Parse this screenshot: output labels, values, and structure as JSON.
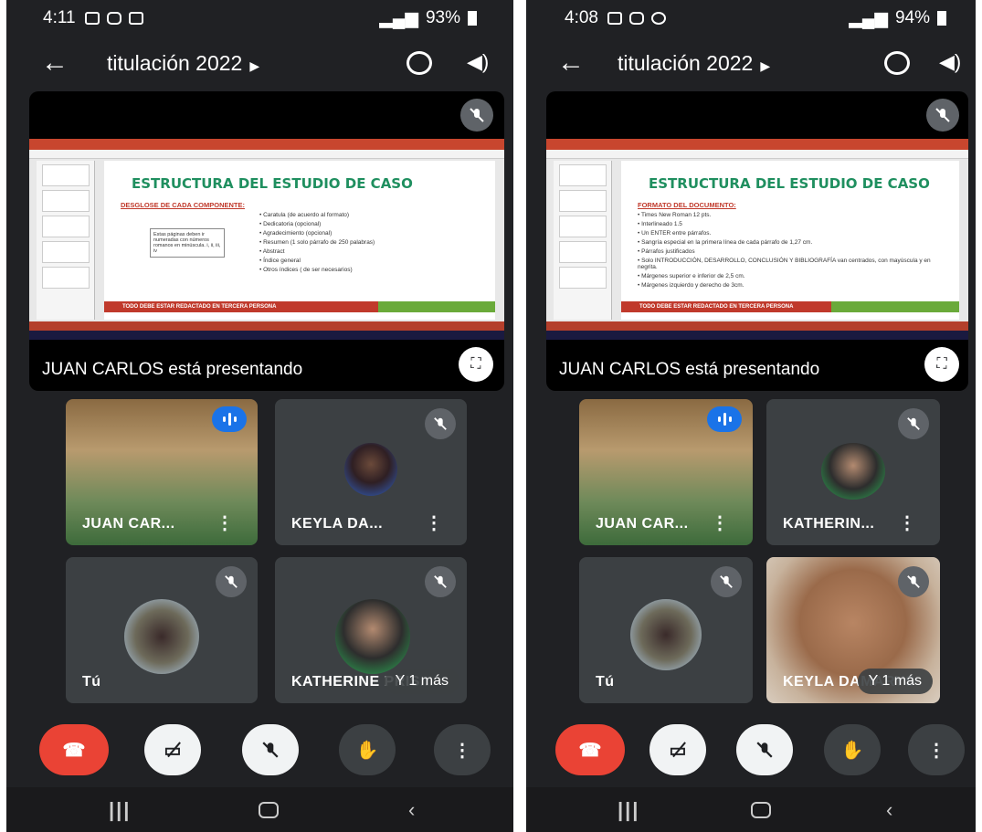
{
  "phones": [
    {
      "status": {
        "time": "4:11",
        "battery": "93%"
      },
      "title": "titulación 2022",
      "slide": {
        "title": "ESTRUCTURA DEL ESTUDIO DE CASO",
        "subtitle": "DESGLOSE DE CADA COMPONENTE:",
        "note": "Estas páginas deben ir numeradas con números romanos en minúscula. i, ii, iii, iv",
        "items": [
          "Caratula (de acuerdo al formato)",
          "Dedicatoria (opcional)",
          "Agradecimiento (opcional)",
          "Resumen (1 solo párrafo de 250 palabras)",
          "Abstract",
          "Índice general",
          "Otros índices ( de ser necesarios)"
        ],
        "banner": "TODO DEBE ESTAR REDACTADO EN TERCERA PERSONA"
      },
      "presenter": "JUAN CARLOS está presentando",
      "tiles": [
        {
          "name": "JUAN CAR...",
          "kind": "video",
          "speaking": true
        },
        {
          "name": "KEYLA DA...",
          "kind": "avatar",
          "muted": true
        },
        {
          "name": "Tú",
          "kind": "avatar",
          "muted": true
        },
        {
          "name": "KATHERINE PRIS...",
          "kind": "avatar",
          "muted": true,
          "more": "Y 1 más"
        }
      ]
    },
    {
      "status": {
        "time": "4:08",
        "battery": "94%"
      },
      "title": "titulación 2022",
      "slide": {
        "title": "ESTRUCTURA DEL ESTUDIO DE CASO",
        "subtitle": "FORMATO DEL DOCUMENTO:",
        "items": [
          "Times New Roman 12 pts.",
          "Interlineado 1.5",
          "Un ENTER entre párrafos.",
          "Sangría especial en la primera línea de cada párrafo de 1,27 cm.",
          "Párrafos justificados",
          "Solo INTRODUCCIÓN, DESARROLLO, CONCLUSIÓN Y BIBLIOGRAFÍA van centrados, con mayúscula y en negrita.",
          "Márgenes superior e inferior de 2,5 cm.",
          "Márgenes izquierdo y derecho de 3cm."
        ],
        "banner": "TODO DEBE ESTAR REDACTADO EN TERCERA PERSONA"
      },
      "presenter": "JUAN CARLOS está presentando",
      "tiles": [
        {
          "name": "JUAN CAR...",
          "kind": "video",
          "speaking": true
        },
        {
          "name": "KATHERIN...",
          "kind": "avatar",
          "muted": true
        },
        {
          "name": "Tú",
          "kind": "avatar",
          "muted": true
        },
        {
          "name": "KEYLA DAMARYS",
          "kind": "video",
          "muted": true,
          "more": "Y 1 más"
        }
      ]
    }
  ],
  "icons": {
    "back": "arrow-left-icon",
    "camera_switch": "camera-switch-icon",
    "speaker": "speaker-icon",
    "mic_off": "mic-off-icon",
    "fullscreen": "fullscreen-icon",
    "end_call": "phone-hangup-icon",
    "camera_off": "camera-off-icon",
    "raise_hand": "hand-icon",
    "more": "more-vert-icon"
  },
  "colors": {
    "end_call": "#ea4335",
    "speaking": "#1a73e8",
    "background": "#202124",
    "tile": "#3c4043"
  }
}
